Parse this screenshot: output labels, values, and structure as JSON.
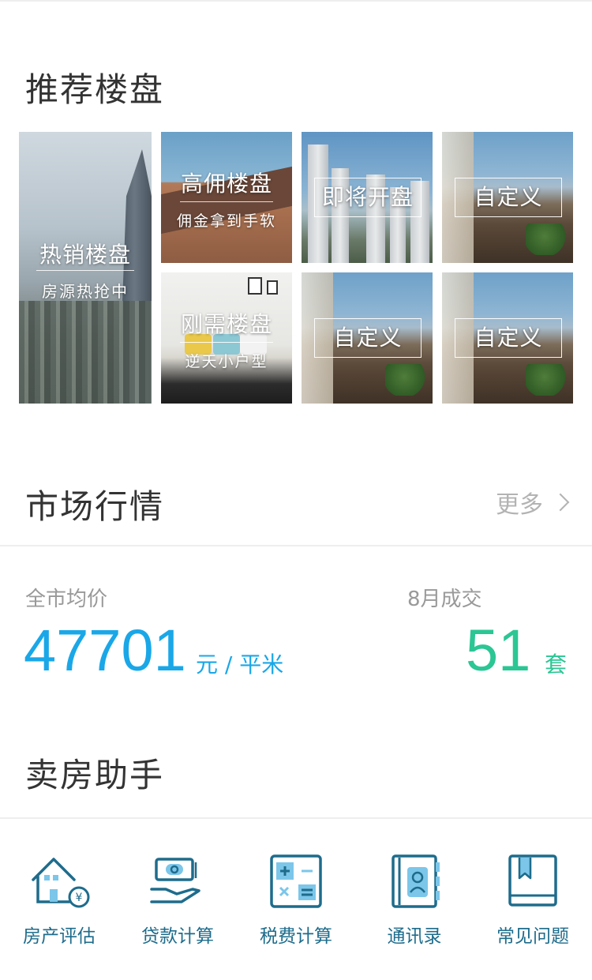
{
  "recommend": {
    "title": "推荐楼盘",
    "hot": {
      "title": "热销楼盘",
      "subtitle": "房源热抢中"
    },
    "commission": {
      "title": "高佣楼盘",
      "subtitle": "佣金拿到手软"
    },
    "rigid": {
      "title": "刚需楼盘",
      "subtitle": "逆天小户型"
    },
    "opening": {
      "title": "即将开盘"
    },
    "custom": [
      "自定义",
      "自定义",
      "自定义"
    ]
  },
  "market": {
    "title": "市场行情",
    "more": "更多",
    "avg_label": "全市均价",
    "avg_value": "47701",
    "avg_unit": "元 / 平米",
    "deal_label": "8月成交",
    "deal_value": "51",
    "deal_unit": "套"
  },
  "assistant": {
    "title": "卖房助手",
    "tools": [
      {
        "label": "房产评估",
        "icon": "house-estimate-icon"
      },
      {
        "label": "贷款计算",
        "icon": "loan-hand-icon"
      },
      {
        "label": "税费计算",
        "icon": "calculator-icon"
      },
      {
        "label": "通讯录",
        "icon": "contacts-book-icon"
      },
      {
        "label": "常见问题",
        "icon": "faq-book-icon"
      }
    ]
  },
  "colors": {
    "accent_blue": "#1aa7e8",
    "accent_green": "#2bc694",
    "icon_teal": "#1e6c8c"
  }
}
